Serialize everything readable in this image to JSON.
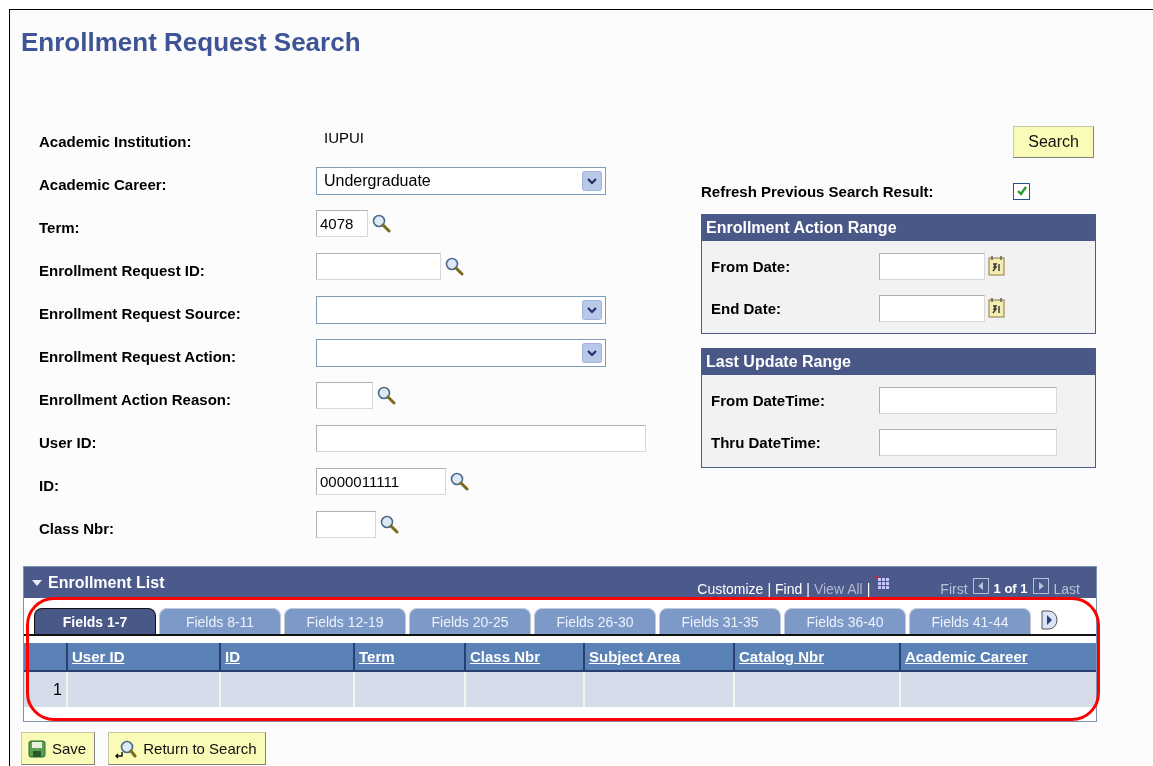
{
  "page_title": "Enrollment Request Search",
  "fields": [
    {
      "kind": "display",
      "label": "Academic Institution:",
      "value": "IUPUI"
    },
    {
      "kind": "dropdown",
      "label": "Academic Career:",
      "value": "Undergraduate"
    },
    {
      "kind": "lookup",
      "label": "Term:",
      "value": "4078"
    },
    {
      "kind": "lookup",
      "label": "Enrollment Request ID:"
    },
    {
      "kind": "dropdown",
      "label": "Enrollment Request Source:"
    },
    {
      "kind": "dropdown",
      "label": "Enrollment Request Action:"
    },
    {
      "kind": "lookup",
      "label": "Enrollment Action Reason:"
    },
    {
      "kind": "text",
      "label": "User ID:"
    },
    {
      "kind": "lookup",
      "label": "ID:",
      "value": "0000011111"
    },
    {
      "kind": "lookup",
      "label": "Class Nbr:"
    }
  ],
  "search_button": "Search",
  "refresh": {
    "label": "Refresh Previous Search Result:",
    "checked": true
  },
  "groups": [
    {
      "title": "Enrollment Action Range",
      "fields": [
        {
          "kind": "date",
          "label": "From Date:"
        },
        {
          "kind": "date",
          "label": "End Date:"
        }
      ]
    },
    {
      "title": "Last Update Range",
      "fields": [
        {
          "kind": "datetime",
          "label": "From DateTime:"
        },
        {
          "kind": "datetime",
          "label": "Thru DateTime:"
        }
      ]
    }
  ],
  "grid": {
    "title": "Enrollment List",
    "toolbar": [
      {
        "kind": "link",
        "label": "Customize",
        "disabled": false
      },
      {
        "kind": "sep",
        "label": "|"
      },
      {
        "kind": "link",
        "label": "Find",
        "disabled": false
      },
      {
        "kind": "sep",
        "label": "|"
      },
      {
        "kind": "link",
        "label": "View All",
        "disabled": true
      },
      {
        "kind": "sep",
        "label": "|"
      },
      {
        "kind": "grid-icon"
      }
    ],
    "pager": {
      "first": "First",
      "count": "1 of 1",
      "last": "Last"
    },
    "tabs": [
      {
        "label": "Fields 1-7",
        "selected": true
      },
      {
        "label": "Fields 8-11",
        "selected": false
      },
      {
        "label": "Fields 12-19",
        "selected": false
      },
      {
        "label": "Fields 20-25",
        "selected": false
      },
      {
        "label": "Fields 26-30",
        "selected": false
      },
      {
        "label": "Fields 31-35",
        "selected": false
      },
      {
        "label": "Fields 36-40",
        "selected": false
      },
      {
        "label": "Fields 41-44",
        "selected": false
      }
    ],
    "columns": [
      "User ID",
      "ID",
      "Term",
      "Class Nbr",
      "Subject Area",
      "Catalog Nbr",
      "Academic Career"
    ],
    "rows": [
      {
        "number": "1"
      }
    ]
  },
  "highlight_outline": true,
  "buttons": [
    {
      "kind": "save",
      "label": "Save"
    },
    {
      "kind": "return",
      "label": "Return to Search"
    }
  ]
}
